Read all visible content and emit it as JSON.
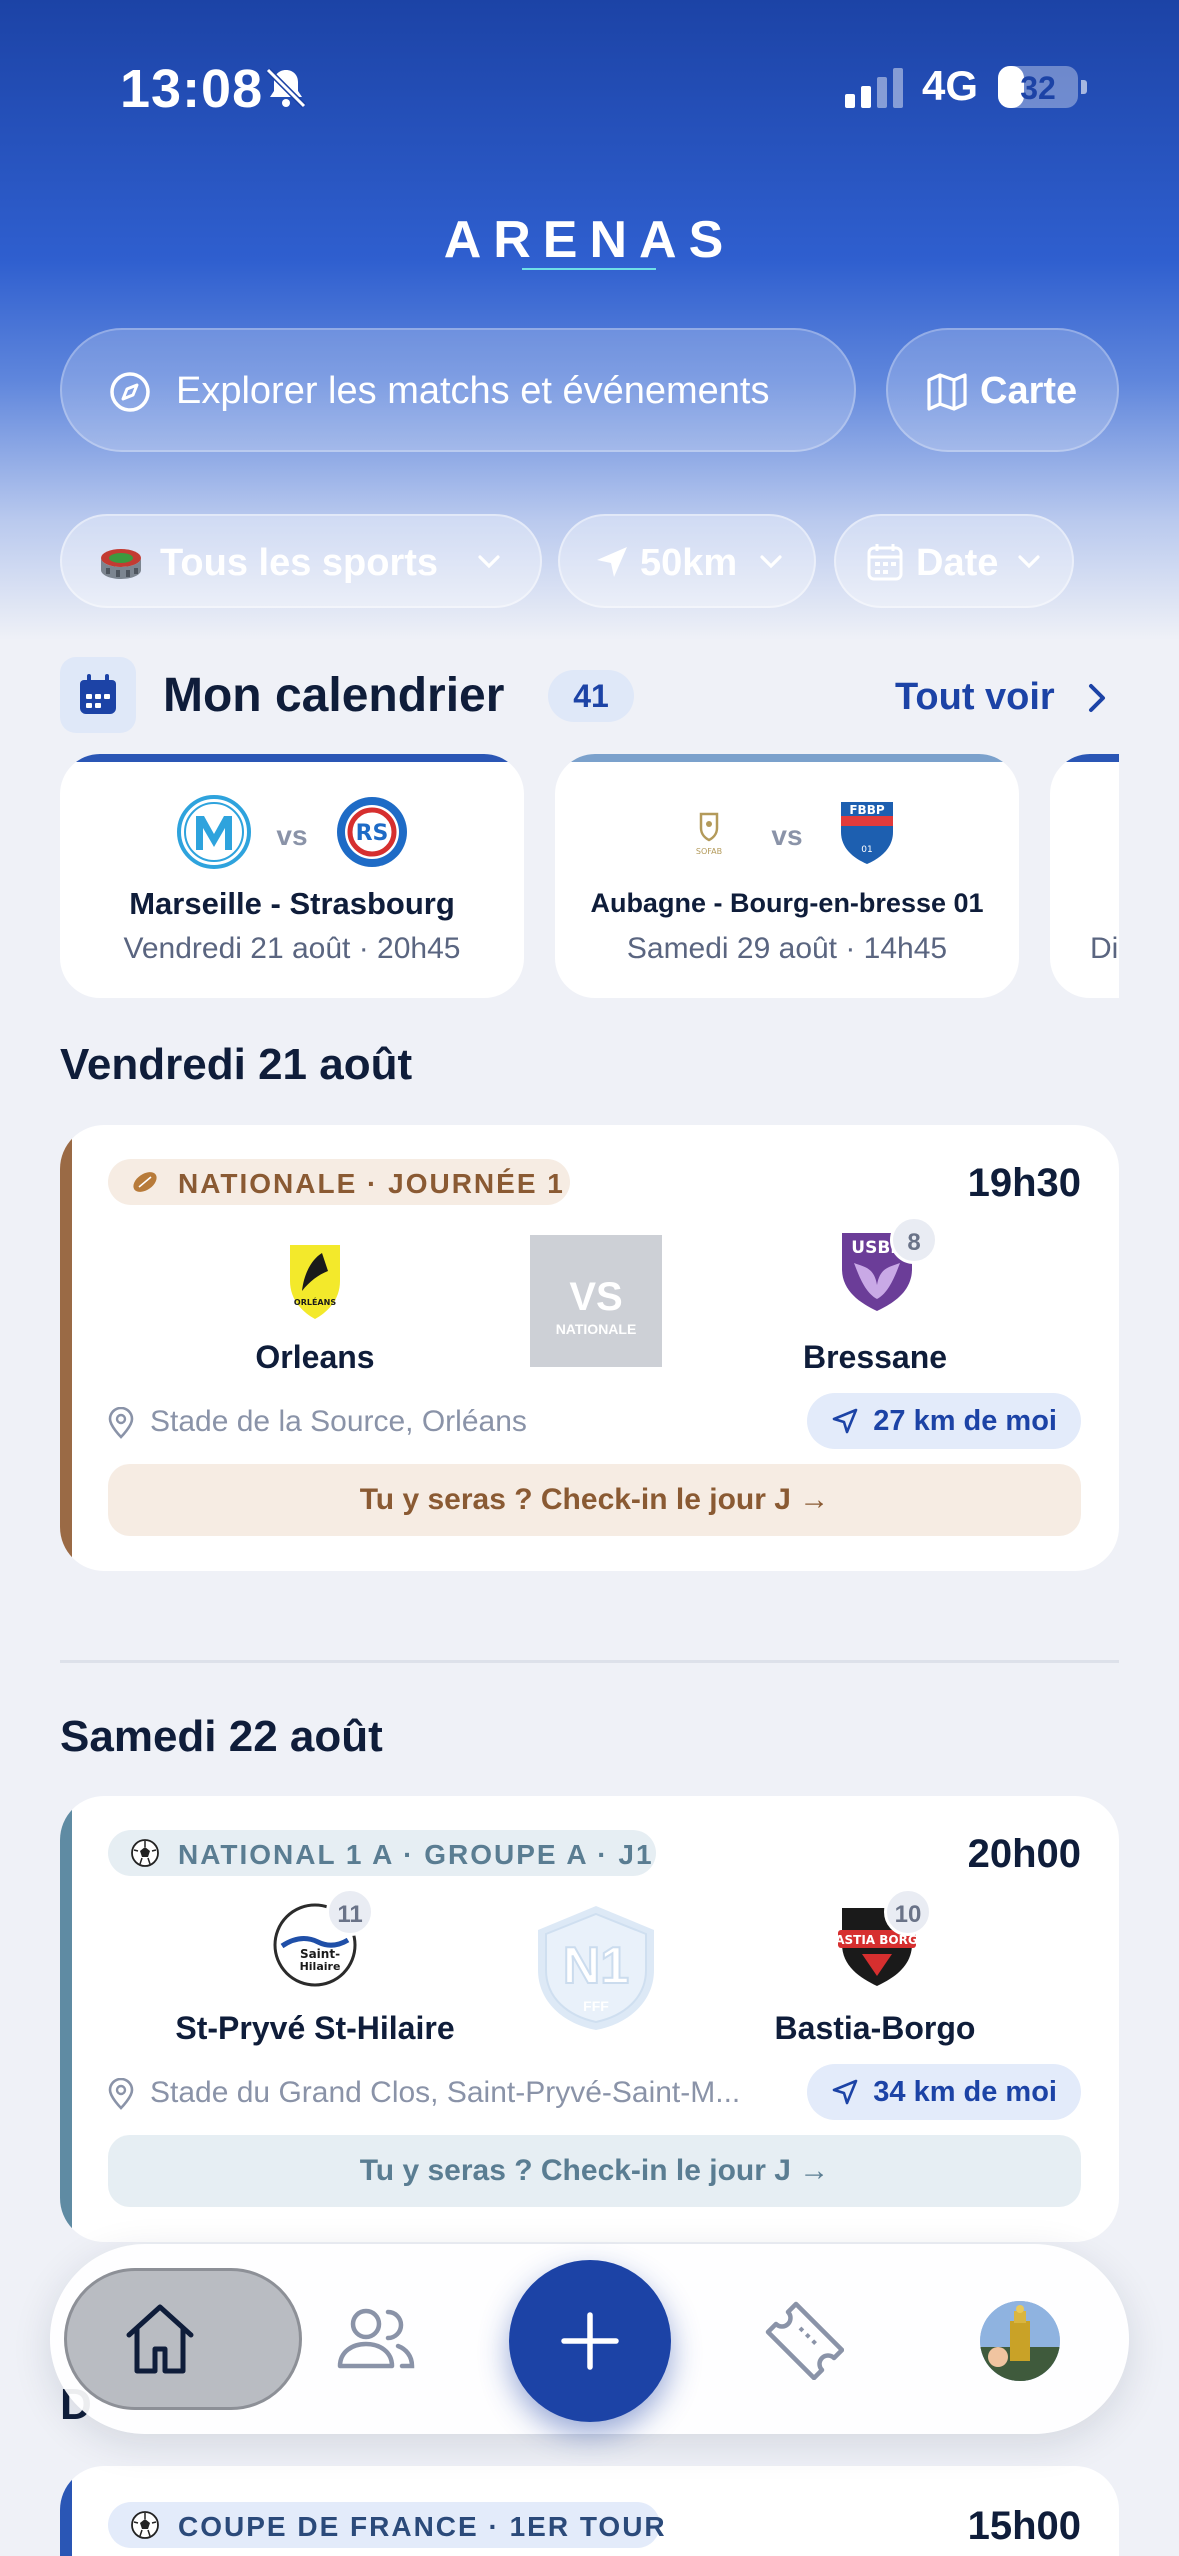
{
  "status_bar": {
    "time": "13:08",
    "network": "4G",
    "battery": "32",
    "battery_level": 0.32
  },
  "app": {
    "title": "ARENAS"
  },
  "search": {
    "placeholder": "Explorer les matchs et événements",
    "map_label": "Carte"
  },
  "filters": [
    {
      "label": "Tous les sports",
      "icon": "stadium-icon"
    },
    {
      "label": "50km",
      "icon": "location-arrow-icon"
    },
    {
      "label": "Date",
      "icon": "calendar-icon"
    }
  ],
  "calendar": {
    "title": "Mon calendrier",
    "count": "41",
    "see_all": "Tout voir",
    "cards": [
      {
        "match": "Marseille - Strasbourg",
        "when": "Vendredi 21 août · 20h45",
        "vs": "vs",
        "strip_color": "#2a56b5"
      },
      {
        "match": "Aubagne - Bourg-en-bresse 01",
        "when": "Samedi 29 août · 14h45",
        "vs": "vs",
        "strip_color": "#7ba1cc"
      },
      {
        "match": "",
        "when": "Di",
        "vs": "",
        "strip_color": "#2a56b5"
      }
    ]
  },
  "days": [
    {
      "heading": "Vendredi 21 août",
      "event": {
        "competition": "NATIONALE · JOURNÉE 1",
        "sport_icon": "rugby-ball-icon",
        "time": "19h30",
        "home": {
          "name": "Orleans",
          "rank": ""
        },
        "away": {
          "name": "Bressane",
          "rank": "8"
        },
        "center_label": "VS",
        "center_sub": "NATIONALE",
        "venue": "Stade de la Source, Orléans",
        "distance": "27 km de moi",
        "checkin": "Tu y seras ? Check-in le jour J →",
        "accent": "#9a6a45"
      }
    },
    {
      "heading": "Samedi 22 août",
      "event": {
        "competition": "NATIONAL 1 A · GROUPE A · J1",
        "sport_icon": "soccer-ball-icon",
        "time": "20h00",
        "home": {
          "name": "St-Pryvé St-Hilaire",
          "rank": "11"
        },
        "away": {
          "name": "Bastia-Borgo",
          "rank": "10"
        },
        "center_label": "N1",
        "center_sub": "FFF",
        "venue": "Stade du Grand Clos, Saint-Pryvé-Saint-M...",
        "distance": "34 km de moi",
        "checkin": "Tu y seras ? Check-in le jour J →",
        "accent": "#5f8ba3"
      }
    },
    {
      "heading": "D",
      "event": {
        "competition": "COUPE DE FRANCE · 1ER TOUR",
        "sport_icon": "soccer-ball-icon",
        "time": "15h00"
      }
    }
  ],
  "tab_bar": {
    "items": [
      "home-icon",
      "friends-icon",
      "add-icon",
      "ticket-icon",
      "profile-avatar"
    ]
  }
}
